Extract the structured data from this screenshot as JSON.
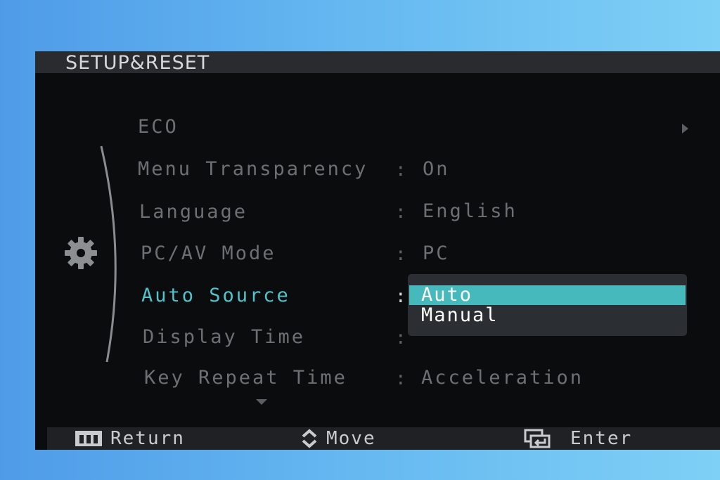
{
  "title": "SETUP&RESET",
  "menu": {
    "items": [
      {
        "label": "ECO",
        "value": "",
        "has_submenu": true
      },
      {
        "label": "Menu Transparency",
        "value": "On"
      },
      {
        "label": "Language",
        "value": "English"
      },
      {
        "label": "PC/AV Mode",
        "value": "PC"
      },
      {
        "label": "Auto Source",
        "value": "",
        "selected": true
      },
      {
        "label": "Display Time",
        "value": ""
      },
      {
        "label": "Key Repeat Time",
        "value": "Acceleration"
      }
    ],
    "separator": ":"
  },
  "dropdown": {
    "options": [
      "Auto",
      "Manual"
    ],
    "highlighted": "Auto"
  },
  "footer": {
    "return_label": "Return",
    "move_label": "Move",
    "enter_label": "Enter"
  },
  "icons": {
    "category": "gear-icon",
    "submenu": "chevron-right-icon",
    "more": "chevron-down-icon",
    "return": "menu-bars-icon",
    "move": "up-down-arrows-icon",
    "enter": "enter-icon"
  },
  "colors": {
    "selected_text": "#4fc4cc",
    "highlight": "#45b9bc",
    "inactive_text": "#6d7073"
  }
}
